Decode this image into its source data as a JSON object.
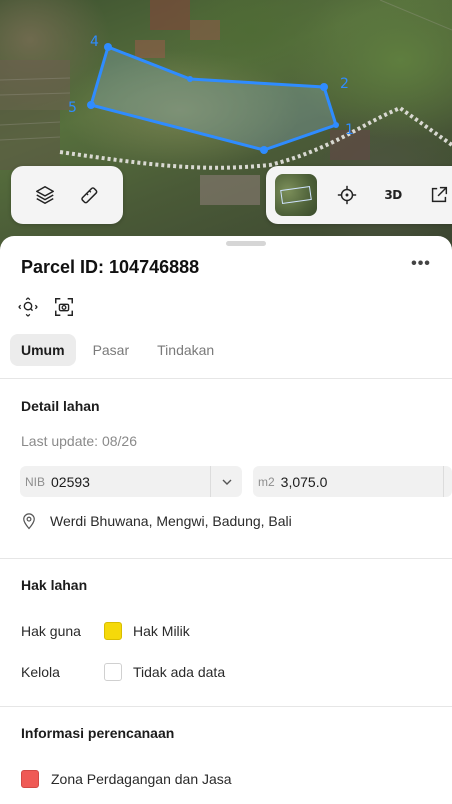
{
  "map": {
    "vertices": [
      "1",
      "2",
      "4",
      "5"
    ],
    "boundary_color": "#2f8cff"
  },
  "map_controls": {
    "left": [
      {
        "icon": "layers-icon"
      },
      {
        "icon": "ruler-icon"
      }
    ],
    "right": [
      {
        "icon": "satellite-thumbnail"
      },
      {
        "icon": "locate-icon"
      },
      {
        "label": "3D"
      },
      {
        "icon": "share-icon"
      }
    ]
  },
  "parcel": {
    "title": "Parcel ID: 104746888",
    "more_label": "•••"
  },
  "tabs": [
    {
      "label": "Umum",
      "active": true
    },
    {
      "label": "Pasar",
      "active": false
    },
    {
      "label": "Tindakan",
      "active": false
    }
  ],
  "detail": {
    "title": "Detail lahan",
    "last_update": "Last update: 08/26",
    "nib_label": "NIB",
    "nib_value": "02593",
    "area_label": "m2",
    "area_value": "3,075.0",
    "location": "Werdi Bhuwana, Mengwi, Badung, Bali"
  },
  "rights": {
    "title": "Hak lahan",
    "rows": [
      {
        "label": "Hak guna",
        "value": "Hak Milik",
        "color": "#f5d90a"
      },
      {
        "label": "Kelola",
        "value": "Tidak ada data",
        "color": "#ffffff"
      }
    ]
  },
  "planning": {
    "title": "Informasi perencanaan",
    "zone": "Zona Perdagangan dan Jasa",
    "zone_color": "#ef5a55"
  }
}
